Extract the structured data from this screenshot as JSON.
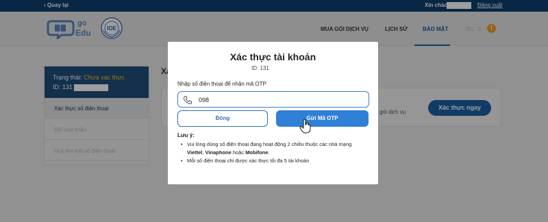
{
  "topbar": {
    "back_label": "Quay lại",
    "greeting": "Xin chào:",
    "logout_label": "Đăng xuất"
  },
  "header": {
    "logo_go": "go",
    "logo_edu": "Edu",
    "seal_text": "IOE",
    "nav": [
      {
        "label": "MUA GÓI DỊCH VỤ"
      },
      {
        "label": "LỊCH SỬ"
      },
      {
        "label": "BẢO MẬT",
        "active": true
      }
    ],
    "coins": "0G : 0",
    "coin_icon": "!"
  },
  "sidebar": {
    "status_label": "Trạng thái:",
    "status_value": "Chưa xác thực",
    "id_label": "ID: 131",
    "items": [
      {
        "label": "Xác thực số điện thoại",
        "selected": true
      },
      {
        "label": "Đổi mật khẩu"
      },
      {
        "label": "Huỷ liên kết số điện thoại"
      }
    ]
  },
  "main": {
    "section_title": "Xác",
    "card_hint": "gói dịch vụ",
    "verify_button": "Xác thực ngay"
  },
  "modal": {
    "title": "Xác thực tài khoản",
    "id_text": "ID: 131",
    "input_label": "Nhập số điện thoại để nhận mã OTP",
    "phone_value": "098",
    "close_button": "Đóng",
    "otp_button": "Gửi Mã OTP",
    "notes_title": "Lưu ý:",
    "note1_prefix": "Vui lòng dùng số điện thoại đang hoạt động 2 chiều thuộc các nhà mạng ",
    "note1_viettel": "Viettel",
    "note1_sep": ", ",
    "note1_vinaphone": "Vinaphone",
    "note1_or": " hoặc ",
    "note1_mobifone": "Mobifone",
    "note1_end": ".",
    "note2": "Mỗi số điện thoại chỉ được xác thực tối đa 5 tài khoản"
  },
  "colors": {
    "topbar": "#0d3f6e",
    "primary": "#2f80d6",
    "status_pending": "#f0c330"
  }
}
